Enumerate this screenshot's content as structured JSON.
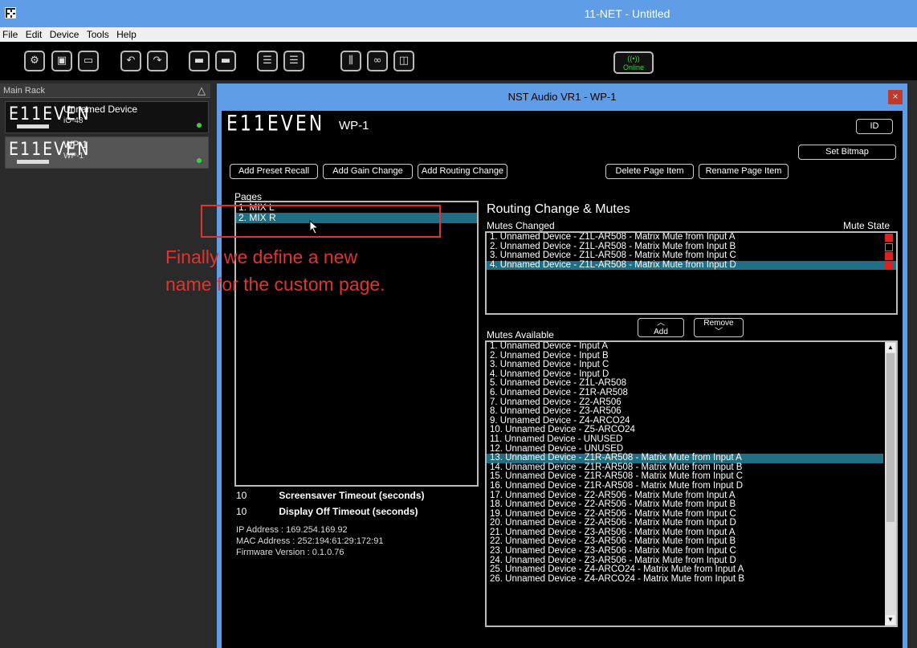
{
  "app_title": "11-NET - Untitled",
  "menu": [
    "File",
    "Edit",
    "Device",
    "Tools",
    "Help"
  ],
  "toolbar": {
    "online_label": "Online"
  },
  "rack": {
    "title": "Main Rack",
    "devices": [
      {
        "name": "Unnamed Device",
        "model": "iO-48",
        "logo": "E11EVEN",
        "selected": false
      },
      {
        "name": "WP-1",
        "model": "WP-1",
        "logo": "E11EVEN",
        "selected": true
      }
    ]
  },
  "window": {
    "title": "NST Audio VR1 - WP-1",
    "close_label": "×",
    "logo": "E11EVEN",
    "device_name": "WP-1",
    "buttons": {
      "id": "ID",
      "set_bitmap": "Set Bitmap",
      "add_preset_recall": "Add Preset Recall",
      "add_gain_change": "Add Gain Change",
      "add_routing_change": "Add Routing Change",
      "delete_page_item": "Delete Page Item",
      "rename_page_item": "Rename Page Item",
      "add": "Add",
      "remove": "Remove"
    },
    "pages_label": "Pages",
    "pages": [
      "1. MIX L",
      "2. MIX R"
    ],
    "selected_page_index": 1,
    "routing_title": "Routing Change & Mutes",
    "mutes_changed_label": "Mutes Changed",
    "mute_state_label": "Mute State",
    "mutes_changed": [
      {
        "label": "1. Unnamed Device - Z1L-AR508 - Matrix Mute from Input A",
        "muted": true
      },
      {
        "label": "2. Unnamed Device - Z1L-AR508 - Matrix Mute from Input B",
        "muted": false
      },
      {
        "label": "3. Unnamed Device - Z1L-AR508 - Matrix Mute from Input C",
        "muted": true
      },
      {
        "label": "4. Unnamed Device - Z1L-AR508 - Matrix Mute from Input D",
        "muted": true
      }
    ],
    "mutes_changed_selected_index": 3,
    "mutes_available_label": "Mutes Available",
    "mutes_available": [
      "1. Unnamed Device - Input A",
      "2. Unnamed Device - Input B",
      "3. Unnamed Device - Input C",
      "4. Unnamed Device - Input D",
      "5. Unnamed Device - Z1L-AR508",
      "6. Unnamed Device - Z1R-AR508",
      "7. Unnamed Device - Z2-AR506",
      "8. Unnamed Device - Z3-AR506",
      "9. Unnamed Device - Z4-ARCO24",
      "10. Unnamed Device - Z5-ARCO24",
      "11. Unnamed Device - UNUSED",
      "12. Unnamed Device - UNUSED",
      "13. Unnamed Device - Z1R-AR508 - Matrix Mute from Input A",
      "14. Unnamed Device - Z1R-AR508 - Matrix Mute from Input B",
      "15. Unnamed Device - Z1R-AR508 - Matrix Mute from Input C",
      "16. Unnamed Device - Z1R-AR508 - Matrix Mute from Input D",
      "17. Unnamed Device - Z2-AR506 - Matrix Mute from Input A",
      "18. Unnamed Device - Z2-AR506 - Matrix Mute from Input B",
      "19. Unnamed Device - Z2-AR506 - Matrix Mute from Input C",
      "20. Unnamed Device - Z2-AR506 - Matrix Mute from Input D",
      "21. Unnamed Device - Z3-AR506 - Matrix Mute from Input A",
      "22. Unnamed Device - Z3-AR506 - Matrix Mute from Input B",
      "23. Unnamed Device - Z3-AR506 - Matrix Mute from Input C",
      "24. Unnamed Device - Z3-AR506 - Matrix Mute from Input D",
      "25. Unnamed Device - Z4-ARCO24 - Matrix Mute from Input A",
      "26. Unnamed Device - Z4-ARCO24 - Matrix Mute from Input B"
    ],
    "mutes_available_selected_index": 12,
    "screensaver_value": "10",
    "screensaver_label": "Screensaver Timeout (seconds)",
    "display_off_value": "10",
    "display_off_label": "Display Off Timeout (seconds)",
    "ip_address": "IP Address : 169.254.169.92",
    "mac_address": "MAC Address : 252:194:61:29:172:91",
    "firmware": "Firmware Version : 0.1.0.76"
  },
  "annotation": {
    "lines": [
      "Finally we define a new",
      "name for the custom page."
    ],
    "color": "#e0342f"
  },
  "colors": {
    "titlebar": "#5f9ee6",
    "selection": "#1e6f86",
    "led_on": "#39d339",
    "mute_on": "#e02020"
  }
}
